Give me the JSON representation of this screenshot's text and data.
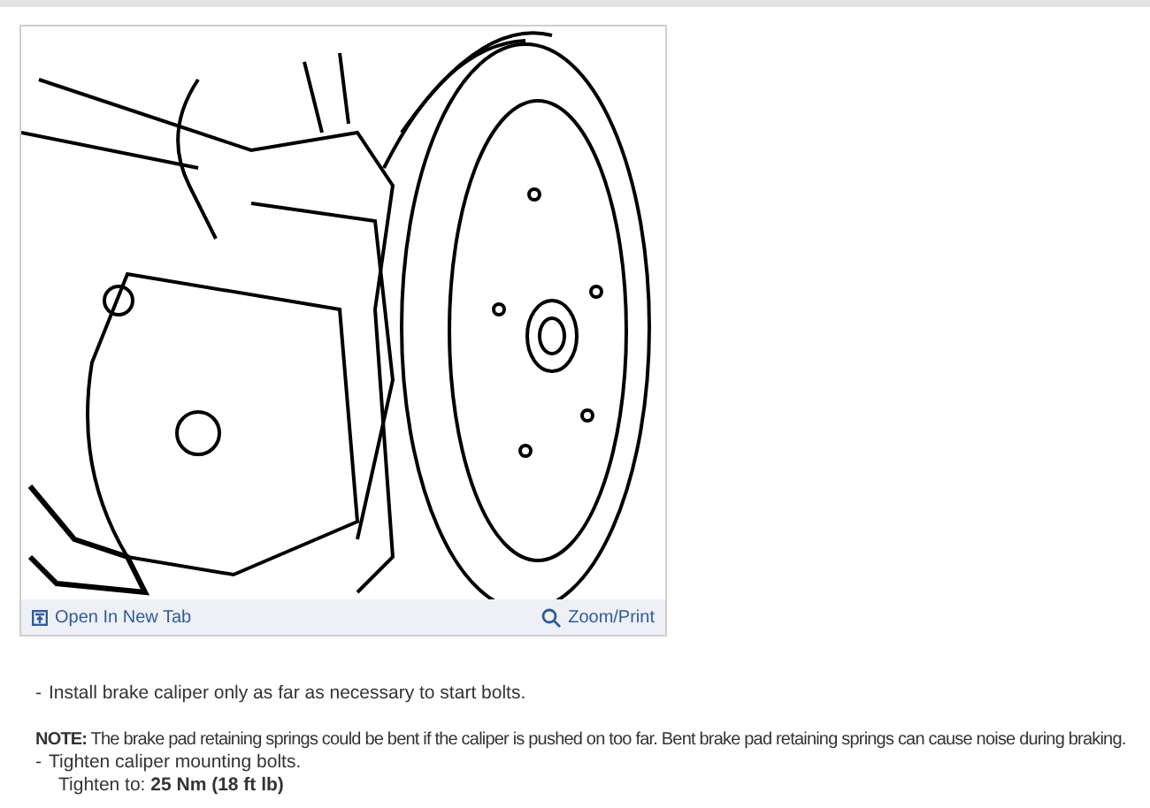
{
  "figure": {
    "links": [
      {
        "kind": "open",
        "label": "Open In New Tab"
      },
      {
        "kind": "zoom",
        "label": "Zoom/Print"
      }
    ]
  },
  "steps": [
    {
      "kind": "bullet",
      "marker": "-",
      "text": "Install brake caliper only as far as necessary to start bolts."
    },
    {
      "kind": "note",
      "text": "**NOTE:** The brake pad retaining springs could be bent if the caliper is pushed on too far. Bent brake pad retaining springs can cause noise during braking."
    },
    {
      "kind": "bullet",
      "marker": "-",
      "text": "Tighten caliper mounting bolts."
    },
    {
      "kind": "indent",
      "text": "Tighten to: **25 Nm (18 ft lb)**"
    }
  ]
}
